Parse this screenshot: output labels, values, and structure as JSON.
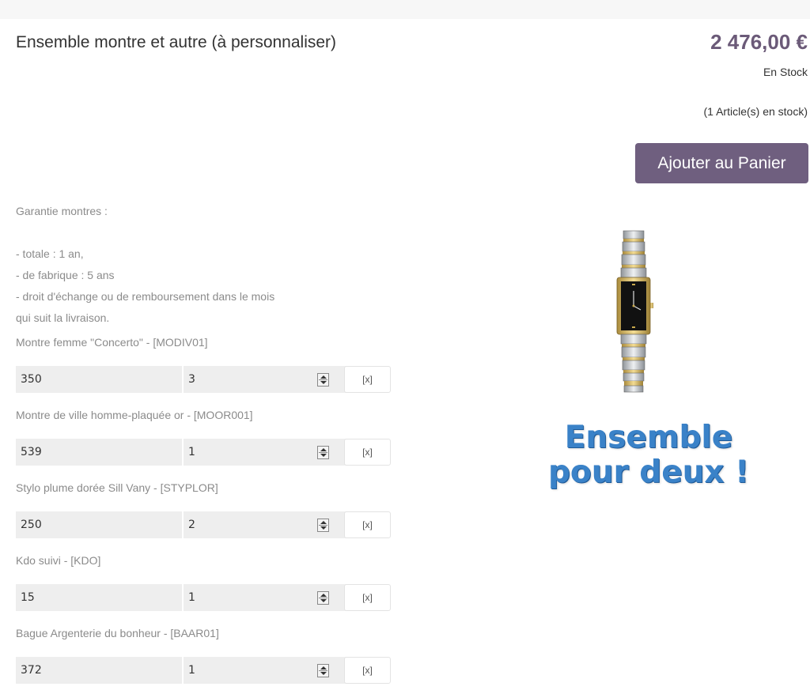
{
  "product": {
    "title": "Ensemble montre et autre (à personnaliser)",
    "price": "2 476,00 €",
    "stock_status": "En Stock",
    "stock_count": "(1 Article(s) en stock)",
    "add_to_cart": "Ajouter au Panier"
  },
  "description": {
    "lines": [
      "Garantie montres :",
      "",
      "- totale : 1 an,",
      "- de fabrique : 5 ans",
      "- droit d'échange ou de remboursement dans le mois",
      "qui suit la livraison."
    ]
  },
  "items": [
    {
      "label": "Montre femme \"Concerto\" - [MODIV01]",
      "value": "350",
      "qty": "3",
      "remove": "[x]"
    },
    {
      "label": "Montre de ville homme-plaquée or - [MOOR001]",
      "value": "539",
      "qty": "1",
      "remove": "[x]"
    },
    {
      "label": "Stylo plume dorée Sill Vany - [STYPLOR]",
      "value": "250",
      "qty": "2",
      "remove": "[x]"
    },
    {
      "label": "Kdo suivi - [KDO]",
      "value": "15",
      "qty": "1",
      "remove": "[x]"
    },
    {
      "label": "Bague Argenterie du bonheur - [BAAR01]",
      "value": "372",
      "qty": "1",
      "remove": "[x]"
    }
  ],
  "image": {
    "promo_line1": "Ensemble",
    "promo_line2": "pour deux !"
  },
  "colors": {
    "accent": "#6f5f7f",
    "price": "#6b5a78",
    "promo": "#3a82c8"
  }
}
